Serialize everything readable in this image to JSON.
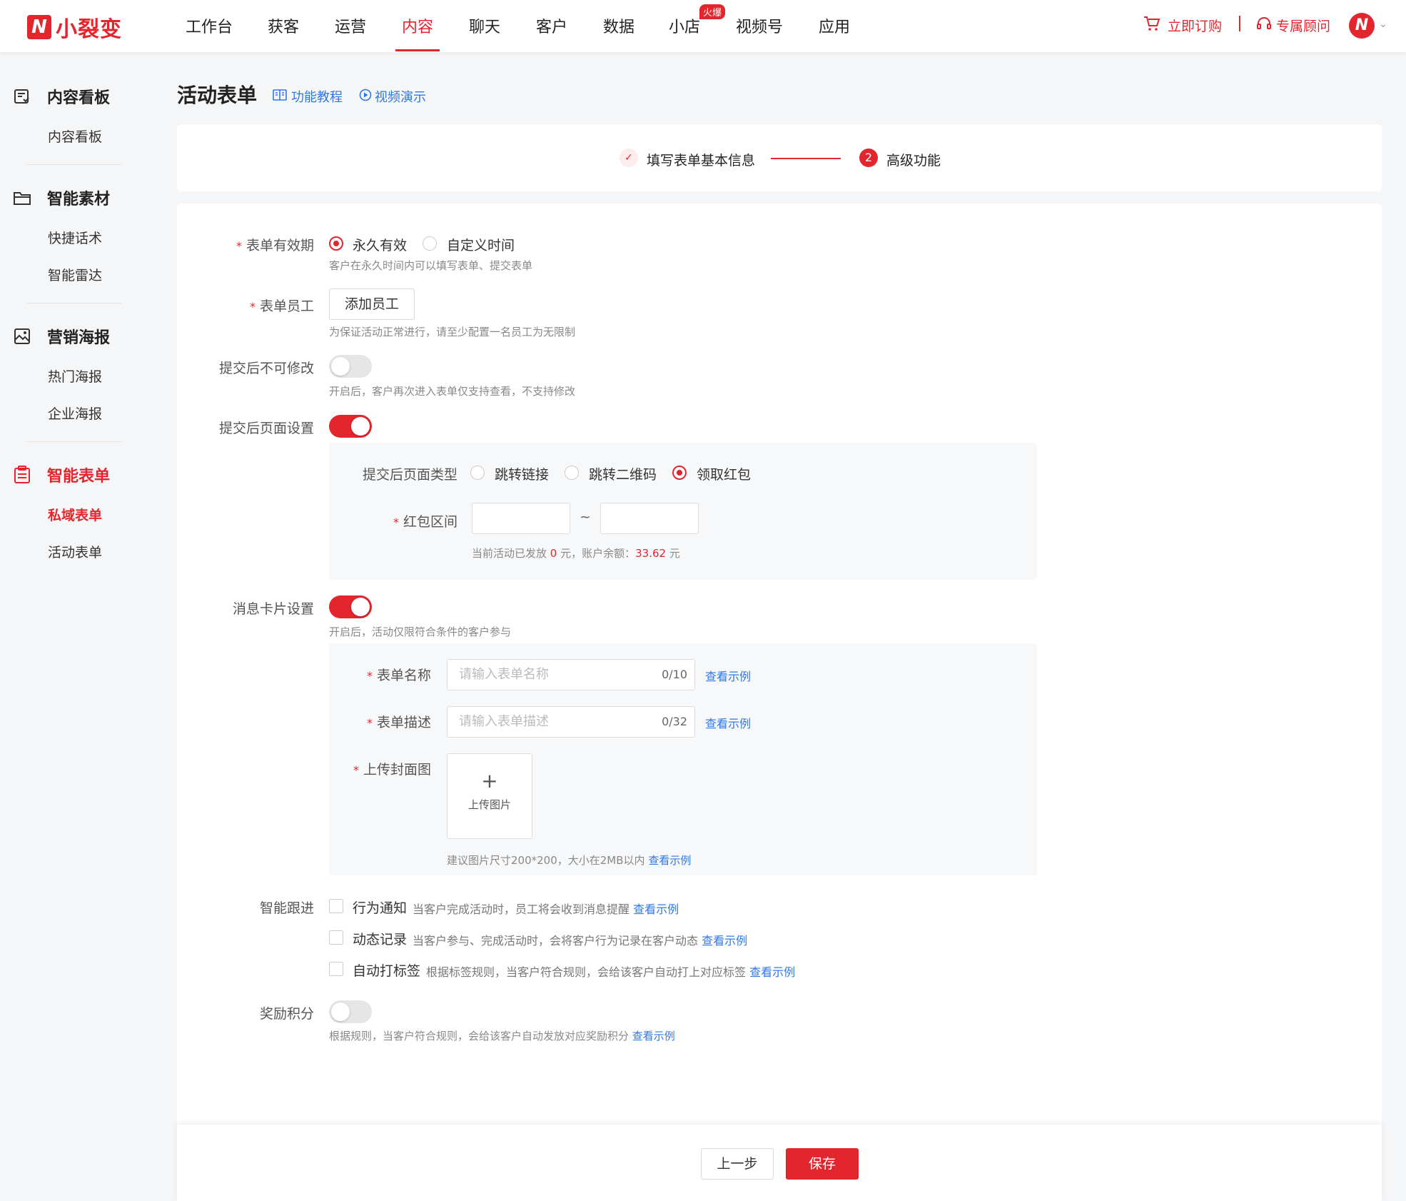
{
  "app": {
    "name": "小裂变"
  },
  "topnav": {
    "items": [
      "工作台",
      "获客",
      "运营",
      "内容",
      "聊天",
      "客户",
      "数据",
      "小店",
      "视频号",
      "应用"
    ],
    "active": "内容",
    "hot_badge": "火爆",
    "subscribe": "立即订购",
    "advisor": "专属顾问"
  },
  "sidebar": {
    "groups": [
      {
        "title": "内容看板",
        "icon": "board-icon",
        "items": [
          "内容看板"
        ]
      },
      {
        "title": "智能素材",
        "icon": "folder-icon",
        "items": [
          "快捷话术",
          "智能雷达"
        ]
      },
      {
        "title": "营销海报",
        "icon": "poster-icon",
        "items": [
          "热门海报",
          "企业海报"
        ]
      },
      {
        "title": "智能表单",
        "icon": "clipboard-icon",
        "items": [
          "私域表单",
          "活动表单"
        ],
        "active": true
      }
    ],
    "active_item": "私域表单"
  },
  "page": {
    "title": "活动表单",
    "tutorial_link": "功能教程",
    "video_link": "视频演示"
  },
  "steps": {
    "step1": "填写表单基本信息",
    "step2_num": "2",
    "step2": "高级功能"
  },
  "form": {
    "validity": {
      "label": "表单有效期",
      "options": [
        "永久有效",
        "自定义时间"
      ],
      "selected": "永久有效",
      "hint": "客户在永久时间内可以填写表单、提交表单"
    },
    "staff": {
      "label": "表单员工",
      "button": "添加员工",
      "hint": "为保证活动正常进行，请至少配置一名员工为无限制"
    },
    "no_edit": {
      "label": "提交后不可修改",
      "enabled": false,
      "hint": "开启后，客户再次进入表单仅支持查看，不支持修改"
    },
    "after_submit": {
      "label": "提交后页面设置",
      "enabled": true,
      "type_label": "提交后页面类型",
      "type_options": [
        "跳转链接",
        "跳转二维码",
        "领取红包"
      ],
      "type_selected": "领取红包",
      "range_label": "红包区间",
      "range_sep": "~",
      "hint_prefix": "当前活动已发放",
      "hint_amount": "0",
      "hint_mid": "元，账户余额：",
      "hint_balance": "33.62",
      "hint_suffix": "元"
    },
    "card": {
      "label": "消息卡片设置",
      "enabled": true,
      "hint": "开启后，活动仅限符合条件的客户参与",
      "name_label": "表单名称",
      "name_placeholder": "请输入表单名称",
      "name_count": "0/10",
      "desc_label": "表单描述",
      "desc_placeholder": "请输入表单描述",
      "desc_count": "0/32",
      "cover_label": "上传封面图",
      "upload_plus": "+",
      "upload_text": "上传图片",
      "cover_hint": "建议图片尺寸200*200，大小在2MB以内",
      "view_example": "查看示例"
    },
    "followup": {
      "label": "智能跟进",
      "items": [
        {
          "title": "行为通知",
          "desc": "当客户完成活动时，员工将会收到消息提醒"
        },
        {
          "title": "动态记录",
          "desc": "当客户参与、完成活动时，会将客户行为记录在客户动态"
        },
        {
          "title": "自动打标签",
          "desc": "根据标签规则，当客户符合规则，会给该客户自动打上对应标签"
        }
      ],
      "view_example": "查看示例"
    },
    "points": {
      "label": "奖励积分",
      "enabled": false,
      "hint": "根据规则，当客户符合规则，会给该客户自动发放对应奖励积分",
      "view_example": "查看示例"
    }
  },
  "footer": {
    "prev": "上一步",
    "save": "保存"
  },
  "colors": {
    "brand": "#e3262d",
    "link": "#2e78e6"
  }
}
